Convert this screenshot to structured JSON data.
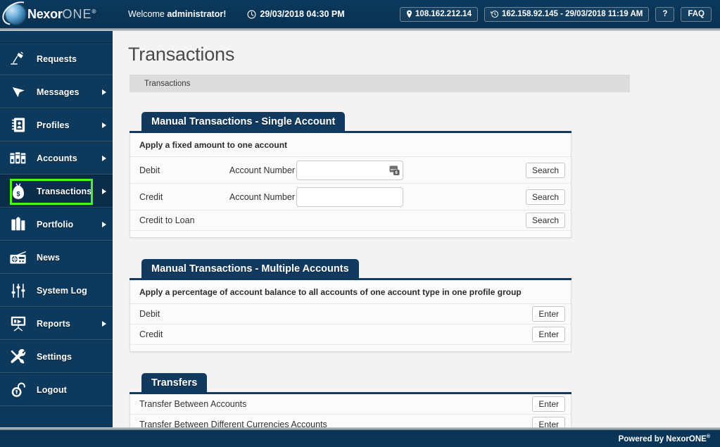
{
  "brand": {
    "name_bold": "Nexor",
    "name_light": "ONE",
    "registered": "®"
  },
  "header": {
    "welcome_prefix": "Welcome ",
    "welcome_user": "administrator!",
    "datetime": "29/03/2018 04:30 PM",
    "clock_icon": "clock-icon",
    "current_ip": "108.162.212.14",
    "current_ip_icon": "location-pin-icon",
    "last_login": "162.158.92.145 - 29/03/2018 11:19 AM",
    "last_login_icon": "history-clock-icon",
    "help_label": "?",
    "faq_label": "FAQ"
  },
  "sidebar": {
    "items": [
      {
        "label": "Requests",
        "icon": "desk-lamp-icon",
        "arrow": false,
        "active": false
      },
      {
        "label": "Messages",
        "icon": "cursor-arrow-icon",
        "arrow": true,
        "active": false
      },
      {
        "label": "Profiles",
        "icon": "address-book-icon",
        "arrow": true,
        "active": false
      },
      {
        "label": "Accounts",
        "icon": "binders-icon",
        "arrow": true,
        "active": false
      },
      {
        "label": "Transactions",
        "icon": "money-bag-icon",
        "arrow": true,
        "active": true
      },
      {
        "label": "Portfolio",
        "icon": "briefcase-icon",
        "arrow": true,
        "active": false
      },
      {
        "label": "News",
        "icon": "radio-icon",
        "arrow": false,
        "active": false
      },
      {
        "label": "System Log",
        "icon": "sliders-icon",
        "arrow": false,
        "active": false
      },
      {
        "label": "Reports",
        "icon": "presentation-icon",
        "arrow": true,
        "active": false
      },
      {
        "label": "Settings",
        "icon": "tools-icon",
        "arrow": false,
        "active": false
      },
      {
        "label": "Logout",
        "icon": "unlock-icon",
        "arrow": false,
        "active": false
      }
    ],
    "highlight_color": "#3dfa22",
    "background_color": "#0d3a5c"
  },
  "page": {
    "title": "Transactions",
    "breadcrumb": "Transactions"
  },
  "panels": {
    "single": {
      "tab_title": "Manual Transactions - Single Account",
      "caption": "Apply a fixed amount to one account",
      "rows": [
        {
          "label": "Debit",
          "field_label": "Account Number",
          "value": "",
          "placeholder": "",
          "button": "Search",
          "has_input": true,
          "has_autofill": true
        },
        {
          "label": "Credit",
          "field_label": "Account Number",
          "value": "",
          "placeholder": "",
          "button": "Search",
          "has_input": true,
          "has_autofill": false
        },
        {
          "label": "Credit to Loan",
          "field_label": "",
          "value": "",
          "placeholder": "",
          "button": "Search",
          "has_input": false,
          "has_autofill": false
        }
      ]
    },
    "multiple": {
      "tab_title": "Manual Transactions - Multiple Accounts",
      "caption": "Apply a percentage of account balance to all accounts of one account type in one profile group",
      "rows": [
        {
          "label": "Debit",
          "button": "Enter"
        },
        {
          "label": "Credit",
          "button": "Enter"
        }
      ]
    },
    "transfers": {
      "tab_title": "Transfers",
      "rows": [
        {
          "label": "Transfer Between Accounts",
          "button": "Enter"
        },
        {
          "label": "Transfer Between Different Currencies Accounts",
          "button": "Enter"
        }
      ]
    }
  },
  "footer": {
    "text": "Powered by NexorONE",
    "registered": "®"
  },
  "colors": {
    "navy": "#0a3556",
    "panel_header": "#123a5e",
    "highlight_green": "#3dfa22",
    "page_bg": "#f3f3f3"
  }
}
